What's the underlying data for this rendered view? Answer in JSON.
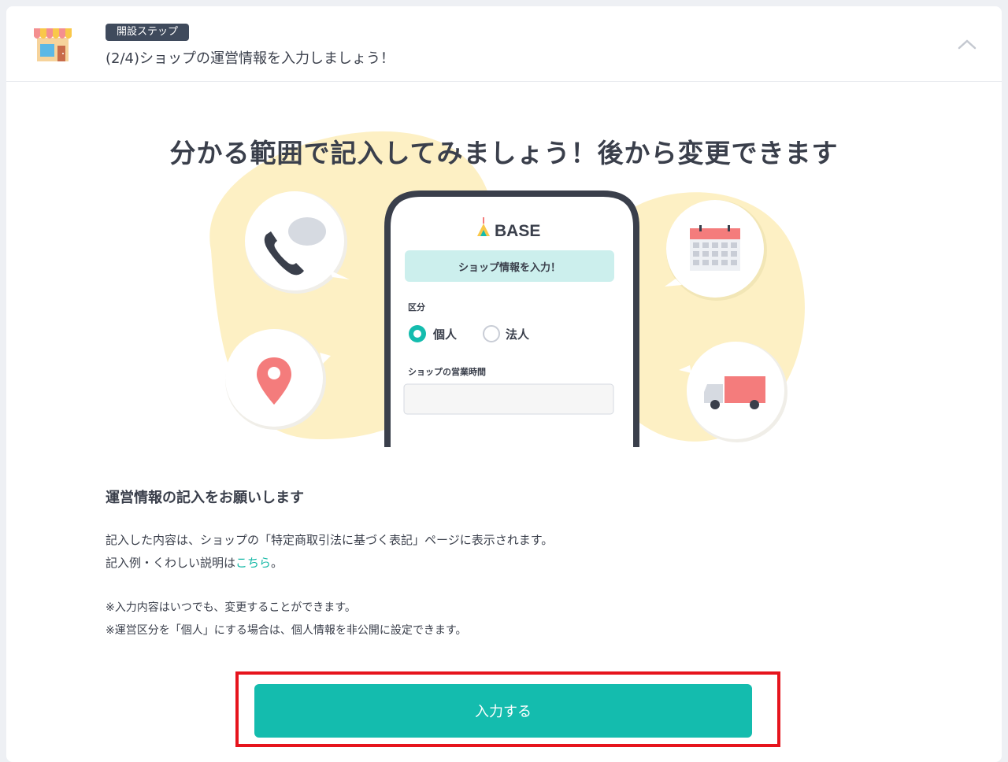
{
  "header": {
    "badge": "開設ステップ",
    "title": "(2/4)ショップの運営情報を入力しましょう！",
    "icon": "shop-icon",
    "collapse_icon": "chevron-up-icon"
  },
  "hero": {
    "title": "分かる範囲で記入してみましょう！後から変更できます"
  },
  "illustration": {
    "logo_text": "BASE",
    "banner": "ショップ情報を入力！",
    "field_label": "区分",
    "radio_options": [
      "個人",
      "法人"
    ],
    "selected_option": "個人",
    "hours_label": "ショップの営業時間",
    "icons": [
      "phone-chat-icon",
      "calendar-icon",
      "map-pin-icon",
      "delivery-truck-icon"
    ]
  },
  "content": {
    "section_title": "運営情報の記入をお願いします",
    "p1_line1": "記入した内容は、ショップの「特定商取引法に基づく表記」ページに表示されます。",
    "p1_line2_prefix": "記入例・くわしい説明は",
    "p1_line2_link": "こちら",
    "p1_line2_suffix": "。",
    "note1": "※入力内容はいつでも、変更することができます。",
    "note2": "※運営区分を「個人」にする場合は、個人情報を非公開に設定できます。"
  },
  "actions": {
    "submit_label": "入力する"
  },
  "colors": {
    "accent": "#14bcae",
    "highlight": "#e6141d",
    "blob": "#fdf0c4",
    "badge": "#3f4a5c"
  }
}
